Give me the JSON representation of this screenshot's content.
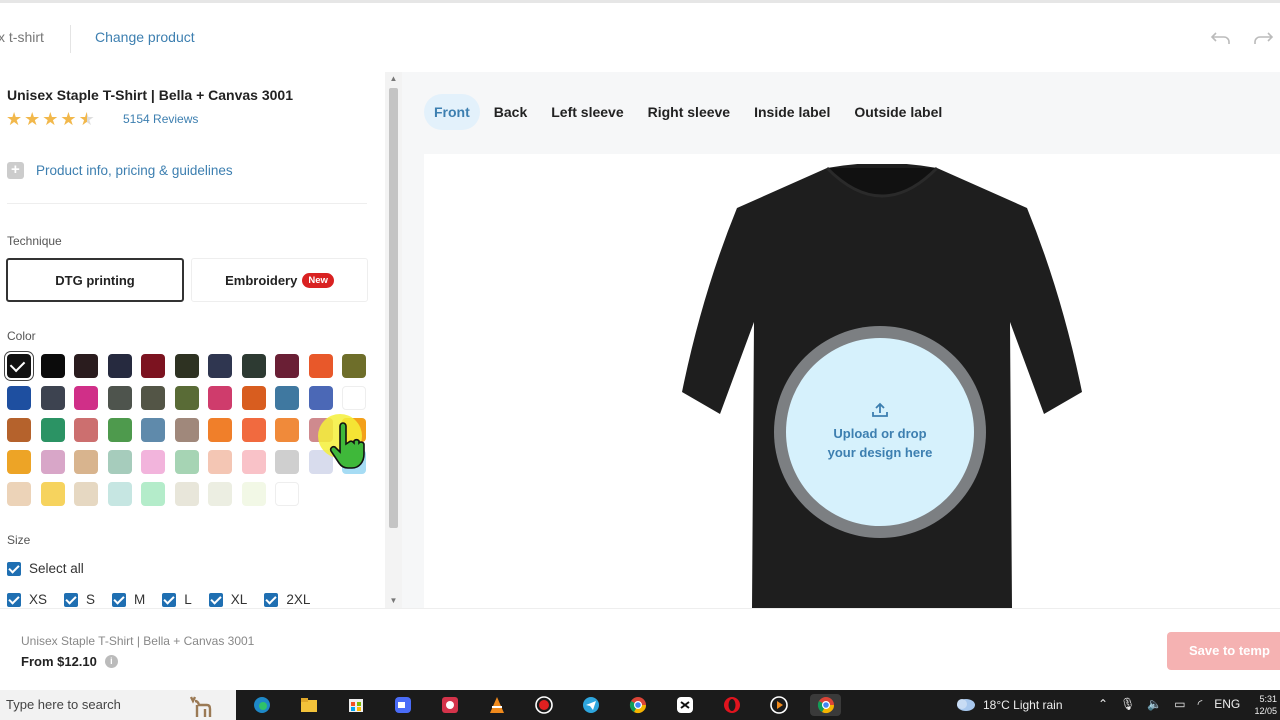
{
  "topbar": {
    "title_fragment": "x t-shirt",
    "change_product": "Change product"
  },
  "product": {
    "name": "Unisex Staple T-Shirt | Bella + Canvas 3001",
    "rating": 4.5,
    "rating_max": 5,
    "reviews": "5154 Reviews",
    "info_link": "Product info, pricing & guidelines"
  },
  "technique": {
    "label": "Technique",
    "options": [
      {
        "label": "DTG printing",
        "selected": true
      },
      {
        "label": "Embroidery",
        "badge": "New",
        "selected": false
      }
    ]
  },
  "color": {
    "label": "Color",
    "swatches": [
      "#111111",
      "#0b0b0b",
      "#2a1c1e",
      "#262a3f",
      "#7c1320",
      "#2e3222",
      "#2f3650",
      "#2d3a32",
      "#6a1f35",
      "#e8582a",
      "#6e6e2a",
      "#1e4fa0",
      "#3d4350",
      "#d02f88",
      "#4e544d",
      "#535546",
      "#596b36",
      "#cf3c6c",
      "#d85d1f",
      "#3f78a0",
      "#4b68b6",
      "#ffffff",
      "#b5622c",
      "#2b9364",
      "#cc6f6f",
      "#4e9a4d",
      "#5f8aab",
      "#a0887b",
      "#f07f2a",
      "#f16a3f",
      "#f08a3a",
      "#cf8a8e",
      "#f3a01a",
      "#eda426",
      "#d8a6c8",
      "#d8b48e",
      "#a6ccbc",
      "#f2b4dc",
      "#a6d4b4",
      "#f4c6b4",
      "#f9c2c8",
      "#cfcfcf",
      "#d8dced",
      "#a6dcf4",
      "#ecd3b8",
      "#f6d35e",
      "#e6d8c2",
      "#c6e6e2",
      "#b4ecca",
      "#e8e6da",
      "#eceee2",
      "#f2f8e6",
      "#ffffff"
    ],
    "selected_index": 0
  },
  "size": {
    "label": "Size",
    "select_all": "Select all",
    "options": [
      "XS",
      "S",
      "M",
      "L",
      "XL",
      "2XL"
    ]
  },
  "views": {
    "tabs": [
      "Front",
      "Back",
      "Left sleeve",
      "Right sleeve",
      "Inside label",
      "Outside label"
    ],
    "active": "Front"
  },
  "upload": {
    "line1": "Upload or drop",
    "line2": "your design here"
  },
  "footer": {
    "product_name": "Unisex Staple T-Shirt | Bella + Canvas 3001",
    "price": "From $12.10",
    "save_button": "Save to temp"
  },
  "taskbar": {
    "search_placeholder": "Type here to search",
    "weather": "18°C  Light rain",
    "language": "ENG",
    "time": "5:31",
    "date": "12/05"
  },
  "colors_theme": {
    "accent": "#3d7fb0",
    "tab_active_bg": "#e3f1fb",
    "badge_red": "#d92121",
    "save_disabled": "#f5b2b2"
  }
}
